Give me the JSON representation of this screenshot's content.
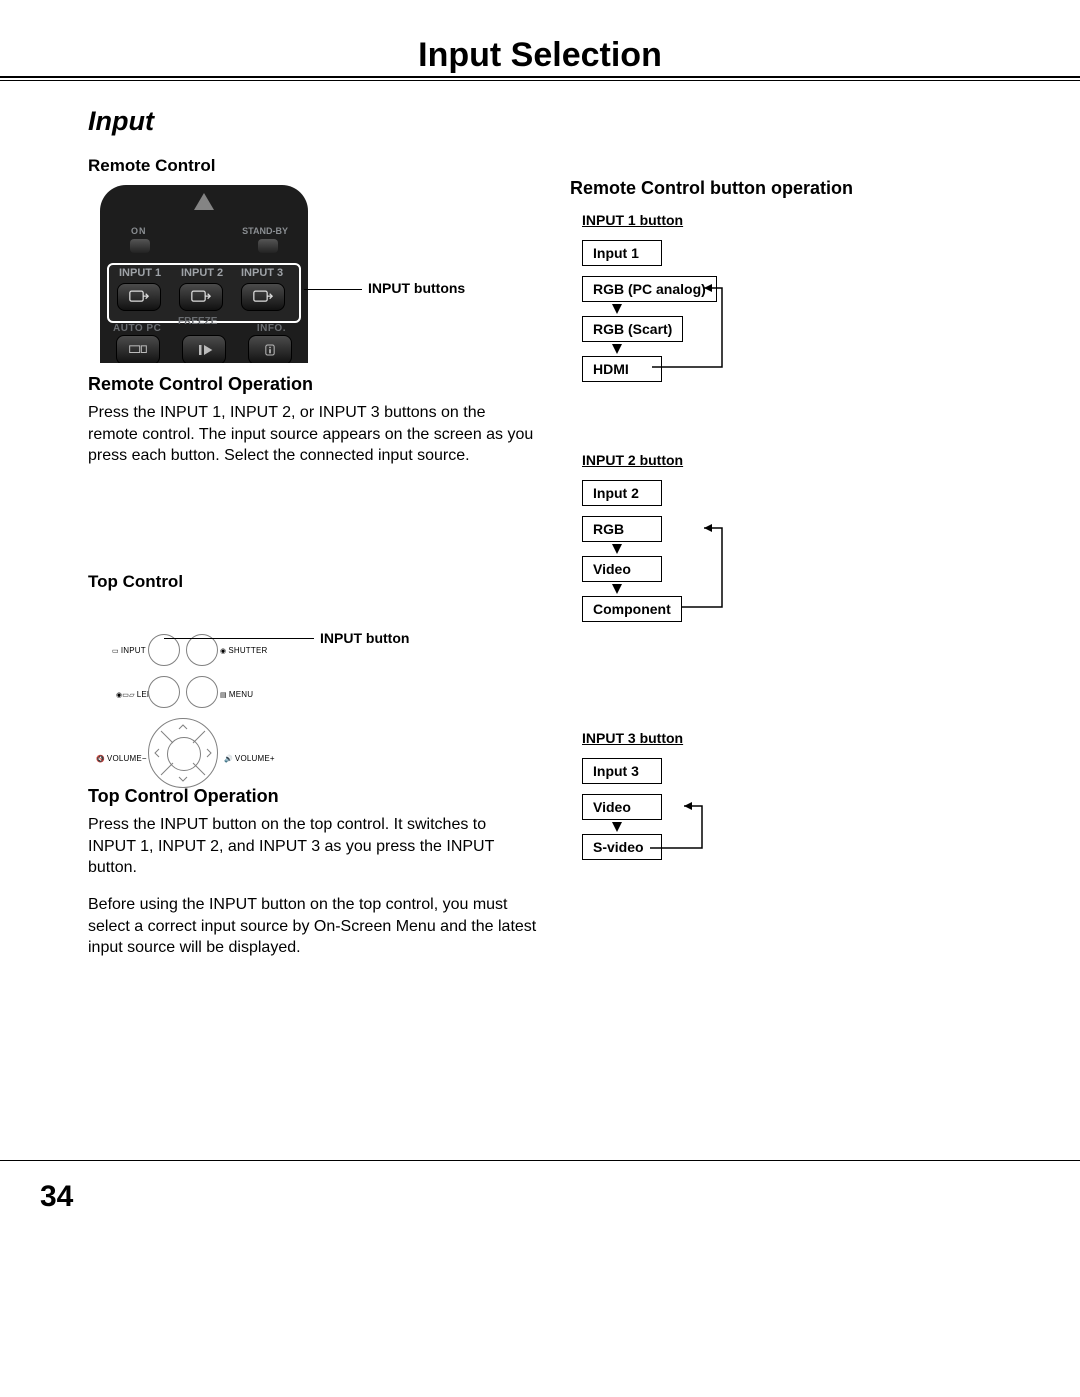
{
  "chapter": "Input Selection",
  "section": "Input",
  "left": {
    "remote_control_heading": "Remote Control",
    "remote": {
      "on": "ON",
      "standby": "STAND-BY",
      "input1": "INPUT 1",
      "input2": "INPUT 2",
      "input3": "INPUT 3",
      "auto": "AUTO PC",
      "freeze": "FREEZE",
      "info": "INFO."
    },
    "callout_input_buttons": "INPUT buttons",
    "rco_heading": "Remote Control Operation",
    "rco_body": "Press the INPUT 1, INPUT 2, or INPUT 3 buttons on the remote control. The input source appears on the screen as you press each button. Select the connected input source.",
    "top_control_heading": "Top Control",
    "topctrl": {
      "input": "INPUT",
      "shutter": "SHUTTER",
      "lens": "LENS",
      "menu": "MENU",
      "vol_minus": "VOLUME−",
      "vol_plus": "VOLUME+"
    },
    "callout_input_button": "INPUT button",
    "tco_heading": "Top Control Operation",
    "tco_body1": "Press the INPUT button on the top control. It switches to INPUT 1, INPUT 2, and INPUT 3 as you press the INPUT button.",
    "tco_body2": "Before using the INPUT button on the top control, you must select a correct input source by On-Screen Menu and the latest input source will be displayed."
  },
  "right": {
    "heading": "Remote Control button operation",
    "d1": {
      "title": "INPUT 1 button",
      "header": "Input 1",
      "items": [
        "RGB (PC analog)",
        "RGB (Scart)",
        "HDMI"
      ]
    },
    "d2": {
      "title": "INPUT 2 button",
      "header": "Input 2",
      "items": [
        "RGB",
        "Video",
        "Component"
      ]
    },
    "d3": {
      "title": "INPUT 3 button",
      "header": "Input 3",
      "items": [
        "Video",
        "S-video"
      ]
    }
  },
  "page_number": "34"
}
